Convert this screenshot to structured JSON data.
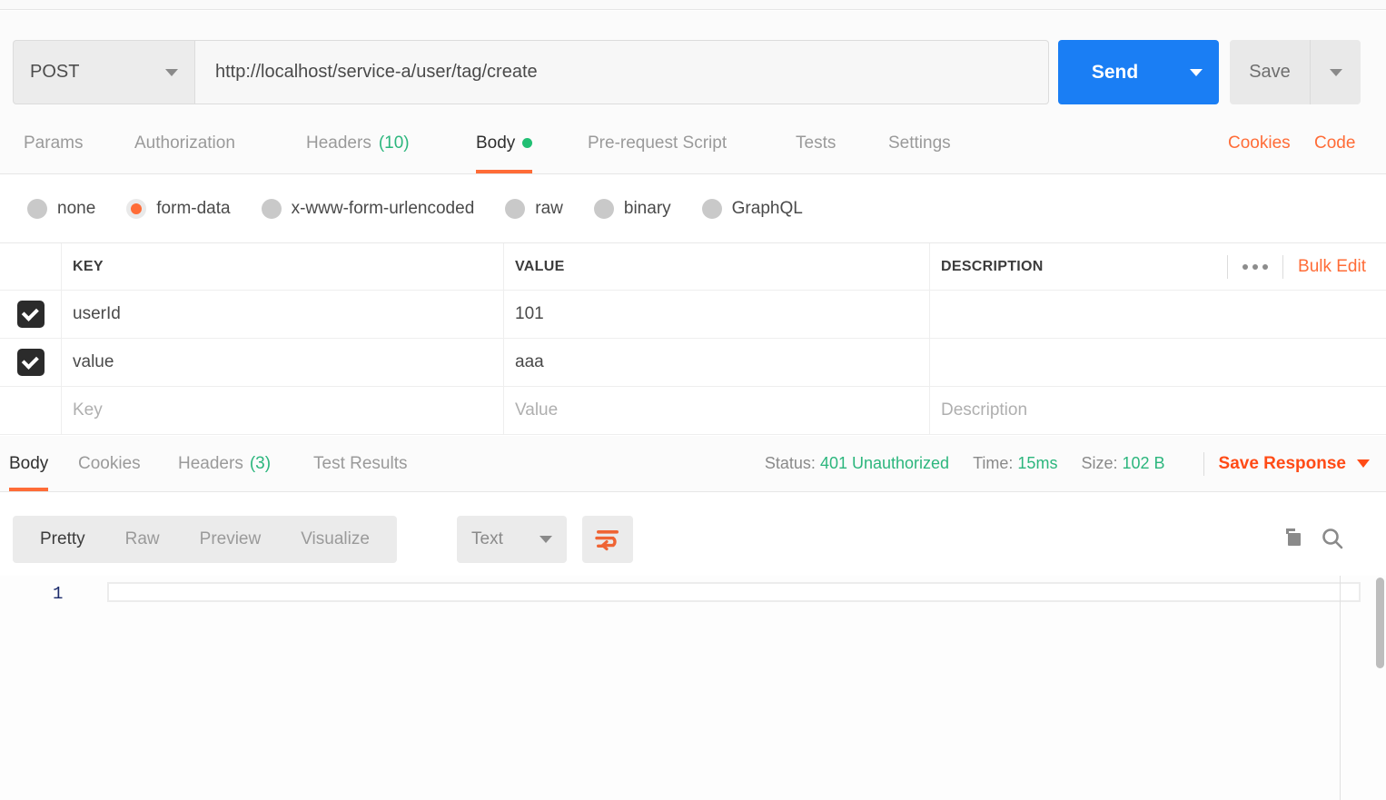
{
  "request": {
    "method": "POST",
    "url": "http://localhost/service-a/user/tag/create",
    "send_label": "Send",
    "save_label": "Save",
    "tabs": [
      {
        "label": "Params",
        "count": "",
        "active": false
      },
      {
        "label": "Authorization",
        "count": "",
        "active": false
      },
      {
        "label": "Headers",
        "count": "(10)",
        "active": false
      },
      {
        "label": "Body",
        "count": "",
        "active": true
      },
      {
        "label": "Pre-request Script",
        "count": "",
        "active": false
      },
      {
        "label": "Tests",
        "count": "",
        "active": false
      },
      {
        "label": "Settings",
        "count": "",
        "active": false
      }
    ],
    "links": [
      {
        "label": "Cookies"
      },
      {
        "label": "Code"
      }
    ],
    "body_types": [
      {
        "label": "none",
        "selected": false
      },
      {
        "label": "form-data",
        "selected": true
      },
      {
        "label": "x-www-form-urlencoded",
        "selected": false
      },
      {
        "label": "raw",
        "selected": false
      },
      {
        "label": "binary",
        "selected": false
      },
      {
        "label": "GraphQL",
        "selected": false
      }
    ],
    "table": {
      "headers": {
        "key": "KEY",
        "value": "VALUE",
        "description": "DESCRIPTION"
      },
      "bulk_edit_label": "Bulk Edit",
      "rows": [
        {
          "checked": true,
          "key": "userId",
          "value": "101",
          "description": ""
        },
        {
          "checked": true,
          "key": "value",
          "value": "aaa",
          "description": ""
        }
      ],
      "placeholder_row": {
        "key": "Key",
        "value": "Value",
        "description": "Description"
      }
    }
  },
  "response": {
    "tabs": [
      {
        "label": "Body",
        "count": "",
        "active": true
      },
      {
        "label": "Cookies",
        "count": "",
        "active": false
      },
      {
        "label": "Headers",
        "count": "(3)",
        "active": false
      },
      {
        "label": "Test Results",
        "count": "",
        "active": false
      }
    ],
    "meta": {
      "status_label": "Status:",
      "status_value": "401 Unauthorized",
      "time_label": "Time:",
      "time_value": "15ms",
      "size_label": "Size:",
      "size_value": "102 B"
    },
    "save_response_label": "Save Response",
    "view_modes": [
      {
        "label": "Pretty",
        "active": true
      },
      {
        "label": "Raw",
        "active": false
      },
      {
        "label": "Preview",
        "active": false
      },
      {
        "label": "Visualize",
        "active": false
      }
    ],
    "format": "Text",
    "code": {
      "line_number": "1",
      "content": ""
    }
  },
  "colors": {
    "accent_orange": "#ff6c37",
    "send_blue": "#1a7ef4",
    "status_green": "#2cb67d"
  }
}
